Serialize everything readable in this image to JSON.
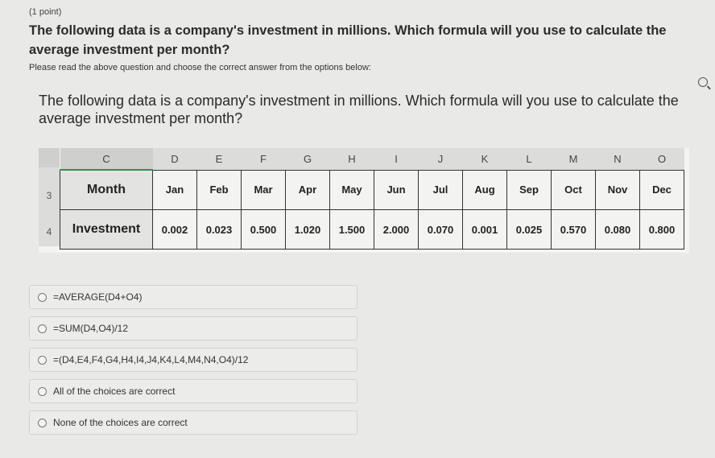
{
  "question": {
    "points": "(1 point)",
    "title": "The following data is a company's investment in millions. Which formula will you use to calculate the average investment per month?",
    "instructions": "Please read the above question and choose the correct answer from the options below:",
    "body": "The following data is a company's investment in millions. Which formula will you use to calculate the average investment per month?"
  },
  "zoom_icon": "zoom-in-icon",
  "spreadsheet": {
    "column_letters": [
      "C",
      "D",
      "E",
      "F",
      "G",
      "H",
      "I",
      "J",
      "K",
      "L",
      "M",
      "N",
      "O"
    ],
    "row_numbers": [
      "3",
      "4"
    ],
    "rows": [
      {
        "label": "Month",
        "values": [
          "Jan",
          "Feb",
          "Mar",
          "Apr",
          "May",
          "Jun",
          "Jul",
          "Aug",
          "Sep",
          "Oct",
          "Nov",
          "Dec"
        ]
      },
      {
        "label": "Investment",
        "values": [
          "0.002",
          "0.023",
          "0.500",
          "1.020",
          "1.500",
          "2.000",
          "0.070",
          "0.001",
          "0.025",
          "0.570",
          "0.080",
          "0.800"
        ]
      }
    ]
  },
  "choices": [
    {
      "label": "=AVERAGE(D4+O4)",
      "selected": false
    },
    {
      "label": "=SUM(D4,O4)/12",
      "selected": false
    },
    {
      "label": "=(D4,E4,F4,G4,H4,I4,J4,K4,L4,M4,N4,O4)/12",
      "selected": false
    },
    {
      "label": "All of the choices are correct",
      "selected": false
    },
    {
      "label": "None of the choices are correct",
      "selected": false
    }
  ]
}
